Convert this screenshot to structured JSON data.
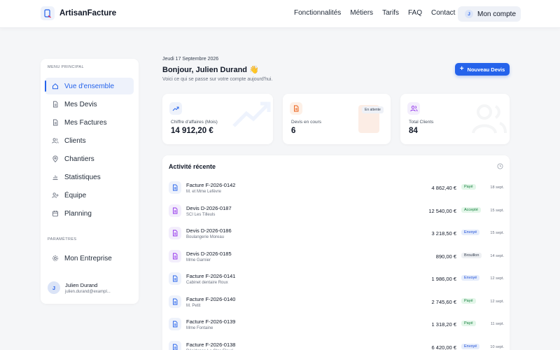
{
  "brand": {
    "name": "ArtisanFacture"
  },
  "nav": {
    "links": [
      "Fonctionnalités",
      "Métiers",
      "Tarifs",
      "FAQ",
      "Contact"
    ],
    "account_label": "Mon compte",
    "account_initial": "J"
  },
  "sidebar": {
    "main_heading": "MENU PRINCIPAL",
    "items": [
      {
        "label": "Vue d'ensemble",
        "icon": "home-icon",
        "active": true
      },
      {
        "label": "Mes Devis",
        "icon": "document-icon"
      },
      {
        "label": "Mes Factures",
        "icon": "invoice-icon"
      },
      {
        "label": "Clients",
        "icon": "users-icon"
      },
      {
        "label": "Chantiers",
        "icon": "map-pin-icon"
      },
      {
        "label": "Statistiques",
        "icon": "chart-icon"
      },
      {
        "label": "Équipe",
        "icon": "user-plus-icon"
      },
      {
        "label": "Planning",
        "icon": "calendar-icon"
      }
    ],
    "settings_heading": "PARAMÈTRES",
    "settings_items": [
      {
        "label": "Mon Entreprise",
        "icon": "gear-icon"
      }
    ],
    "user": {
      "initial": "J",
      "name": "Julien Durand",
      "email": "julien.durand@exampl..."
    }
  },
  "header": {
    "date": "Jeudi 17 Septembre 2026",
    "greeting": "Bonjour, Julien Durand 👋",
    "subtitle": "Voici ce qui se passe sur votre compte aujourd'hui.",
    "new_button": "Nouveau Devis"
  },
  "stats": [
    {
      "label": "Chiffre d'affaires (Mois)",
      "value": "14 912,20 €",
      "icon": "trend-up-icon"
    },
    {
      "label": "Devis en cours",
      "value": "6",
      "icon": "document-icon",
      "badge": "En attente"
    },
    {
      "label": "Total Clients",
      "value": "84",
      "icon": "users-icon"
    }
  ],
  "activity": {
    "title": "Activité récente",
    "rows": [
      {
        "title": "Facture F-2026-0142",
        "client": "M. et Mme Lefèvre",
        "amount": "4 862,40 €",
        "status": "Payé",
        "status_kind": "paye",
        "date": "18 sept.",
        "kind": "facture"
      },
      {
        "title": "Devis D-2026-0187",
        "client": "SCI Les Tilleuls",
        "amount": "12 540,00 €",
        "status": "Accepté",
        "status_kind": "accepte",
        "date": "15 sept.",
        "kind": "devis"
      },
      {
        "title": "Devis D-2026-0186",
        "client": "Boulangerie Moreau",
        "amount": "3 218,50 €",
        "status": "Envoyé",
        "status_kind": "envoye",
        "date": "15 sept.",
        "kind": "devis"
      },
      {
        "title": "Devis D-2026-0185",
        "client": "Mme Garnier",
        "amount": "890,00 €",
        "status": "Brouillon",
        "status_kind": "brouillon",
        "date": "14 sept.",
        "kind": "devis"
      },
      {
        "title": "Facture F-2026-0141",
        "client": "Cabinet dentaire Roux",
        "amount": "1 986,00 €",
        "status": "Envoyé",
        "status_kind": "envoye",
        "date": "12 sept.",
        "kind": "facture"
      },
      {
        "title": "Facture F-2026-0140",
        "client": "M. Petit",
        "amount": "2 745,60 €",
        "status": "Payé",
        "status_kind": "paye",
        "date": "12 sept.",
        "kind": "facture"
      },
      {
        "title": "Facture F-2026-0139",
        "client": "Mme Fontaine",
        "amount": "1 318,20 €",
        "status": "Payé",
        "status_kind": "paye",
        "date": "11 sept.",
        "kind": "facture"
      },
      {
        "title": "Facture F-2026-0138",
        "client": "Résidence Le Clos Fleuri",
        "amount": "6 420,00 €",
        "status": "Envoyé",
        "status_kind": "envoye",
        "date": "10 sept.",
        "kind": "facture"
      }
    ]
  },
  "colors": {
    "accent": "#2563eb",
    "facture": "#2563eb",
    "devis": "#9333ea"
  }
}
